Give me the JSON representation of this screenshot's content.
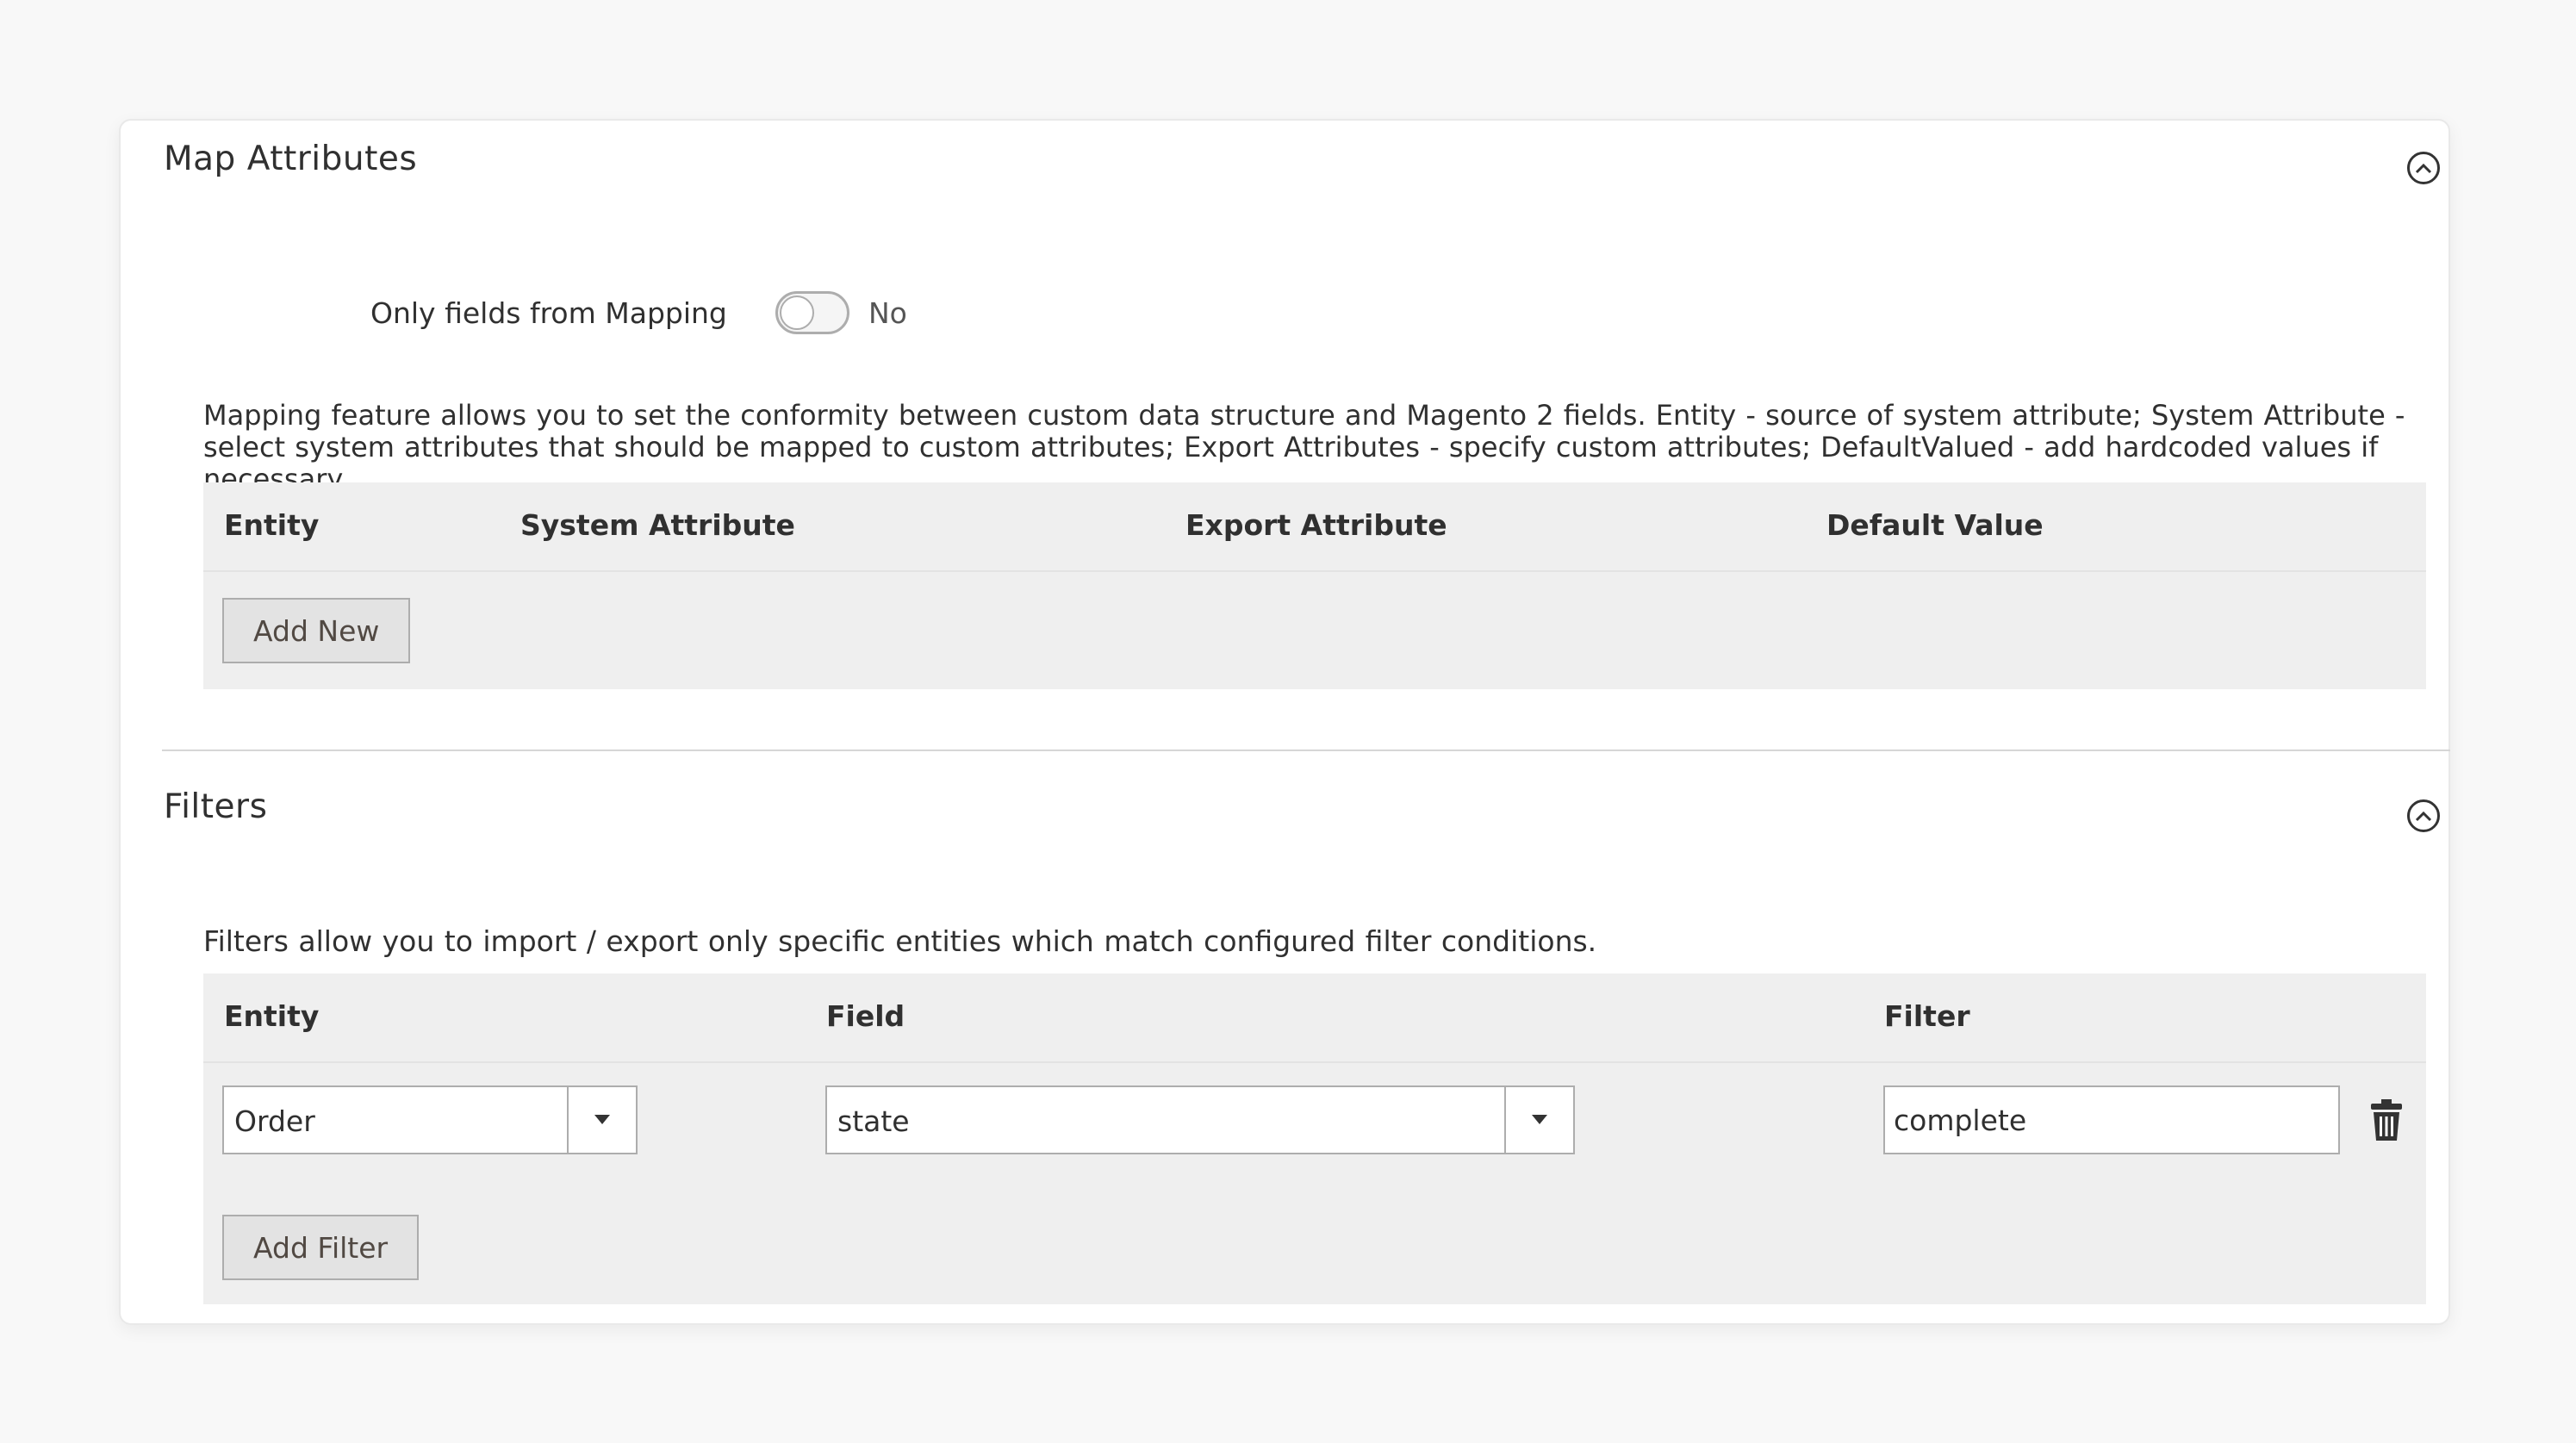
{
  "map_attributes": {
    "title": "Map Attributes",
    "toggle_label": "Only fields from Mapping",
    "toggle_state": "No",
    "description": "Mapping feature allows you to set the conformity between custom data structure and Magento 2 fields. Entity - source of system attribute; System Attribute - select system attributes that should be mapped to custom attributes; Export Attributes - specify custom attributes; DefaultValued - add hardcoded values if necessary.",
    "columns": [
      "Entity",
      "System Attribute",
      "Export Attribute",
      "Default Value"
    ],
    "add_button": "Add New"
  },
  "filters": {
    "title": "Filters",
    "description": "Filters allow you to import / export only specific entities which match configured filter conditions.",
    "columns": [
      "Entity",
      "Field",
      "Filter"
    ],
    "row": {
      "entity": "Order",
      "field": "state",
      "filter": "complete"
    },
    "add_button": "Add Filter"
  },
  "icons": {
    "collapse": "chevron-up-circle-icon",
    "dropdown": "caret-down-icon",
    "delete": "trash-icon"
  }
}
